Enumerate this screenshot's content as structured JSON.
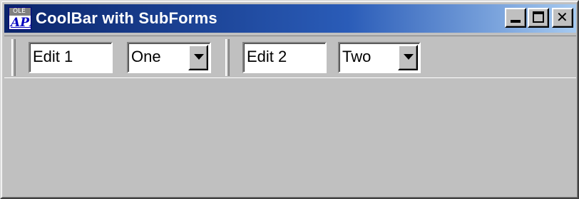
{
  "window": {
    "title": "CoolBar with SubForms",
    "icon_name": "vbapi-app-icon",
    "icon_text_top": "OLE",
    "icon_text_bottom": "API",
    "caption_buttons": {
      "minimize_icon": "minimize-icon",
      "maximize_icon": "maximize-icon",
      "close_icon": "close-icon",
      "close_glyph": "✕"
    },
    "titlebar_colors": [
      "#0a246a",
      "#a6caf0"
    ]
  },
  "coolbar": {
    "bands": [
      {
        "edit_value": "Edit 1",
        "combo_value": "One"
      },
      {
        "edit_value": "Edit 2",
        "combo_value": "Two"
      }
    ]
  }
}
